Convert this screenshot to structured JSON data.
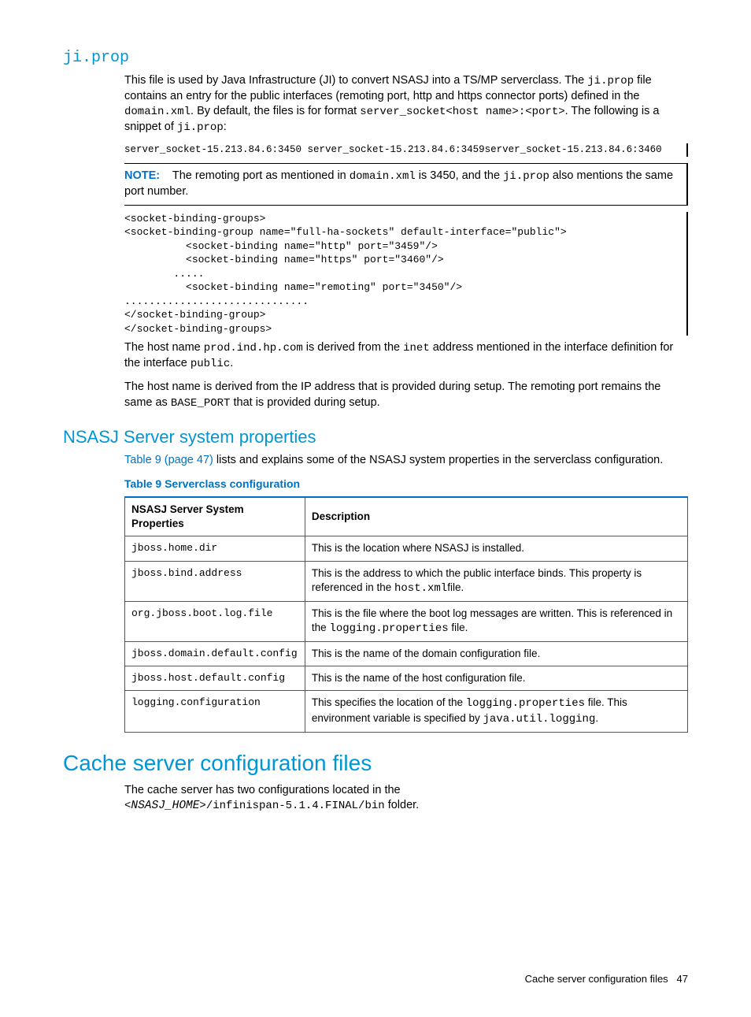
{
  "section1": {
    "heading": "ji.prop",
    "p1_a": "This file is used by Java Infrastructure (JI) to convert NSASJ into a TS/MP serverclass. The ",
    "p1_code1": "ji.prop",
    "p1_b": " file contains an entry for the public interfaces (remoting port, http and https connector ports) defined in the ",
    "p1_code2": "domain.xml",
    "p1_c": ". By default, the files is for format ",
    "p1_code3": "server_socket<host name>:<port>",
    "p1_d": ". The following is a snippet of ",
    "p1_code4": "ji.prop",
    "p1_e": ":",
    "snippet1": "server_socket-15.213.84.6:3450 server_socket-15.213.84.6:3459server_socket-15.213.84.6:3460",
    "note_label": "NOTE:",
    "note_a": "The remoting port as mentioned in ",
    "note_code1": "domain.xml",
    "note_b": " is 3450, and the ",
    "note_code2": "ji.prop",
    "note_c": " also mentions the same port number.",
    "snippet2": "<socket-binding-groups>\n<socket-binding-group name=\"full-ha-sockets\" default-interface=\"public\">\n          <socket-binding name=\"http\" port=\"3459\"/>\n          <socket-binding name=\"https\" port=\"3460\"/>\n        .....\n          <socket-binding name=\"remoting\" port=\"3450\"/>\n..............................\n</socket-binding-group>\n</socket-binding-groups>",
    "p2_a": "The host name ",
    "p2_code1": "prod.ind.hp.com",
    "p2_b": " is derived from the ",
    "p2_code2": "inet",
    "p2_c": " address mentioned in the interface definition for the interface ",
    "p2_code3": "public",
    "p2_d": ".",
    "p3_a": "The host name is derived from the IP address that is provided during setup. The remoting port remains the same as ",
    "p3_code1": "BASE_PORT",
    "p3_b": " that is provided during setup."
  },
  "section2": {
    "heading": "NSASJ Server system properties",
    "p1_link": "Table 9 (page 47)",
    "p1_rest": " lists and explains some of the NSASJ system properties in the serverclass configuration.",
    "table_caption": "Table 9 Serverclass configuration",
    "th1": "NSASJ Server System Properties",
    "th2": "Description",
    "rows": [
      {
        "prop": "jboss.home.dir",
        "desc_a": "This is the location where NSASJ is installed."
      },
      {
        "prop": "jboss.bind.address",
        "desc_a": "This is the address to which the public interface binds. This property is referenced in the ",
        "code1": "host.xml",
        "desc_b": "file."
      },
      {
        "prop": "org.jboss.boot.log.file",
        "desc_a": "This is the file where the boot log messages are written. This is referenced in the ",
        "code1": "logging.properties",
        "desc_b": " file."
      },
      {
        "prop": "jboss.domain.default.config",
        "desc_a": "This is the name of the domain configuration file."
      },
      {
        "prop": "jboss.host.default.config",
        "desc_a": "This is the name of the host configuration file."
      },
      {
        "prop": "logging.configuration",
        "desc_a": "This specifies the location of the ",
        "code1": "logging.properties",
        "desc_b": " file. This environment variable is specified by ",
        "code2": "java.util.logging",
        "desc_c": "."
      }
    ]
  },
  "section3": {
    "heading": "Cache server configuration files",
    "p1_a": "The cache server has two configurations located in the ",
    "p1_code1": "<",
    "p1_code1_it": "NSASJ_HOME",
    "p1_code1b": ">/infinispan-5.1.4.FINAL/bin",
    "p1_b": " folder."
  },
  "footer": {
    "text": "Cache server configuration files",
    "page": "47"
  }
}
